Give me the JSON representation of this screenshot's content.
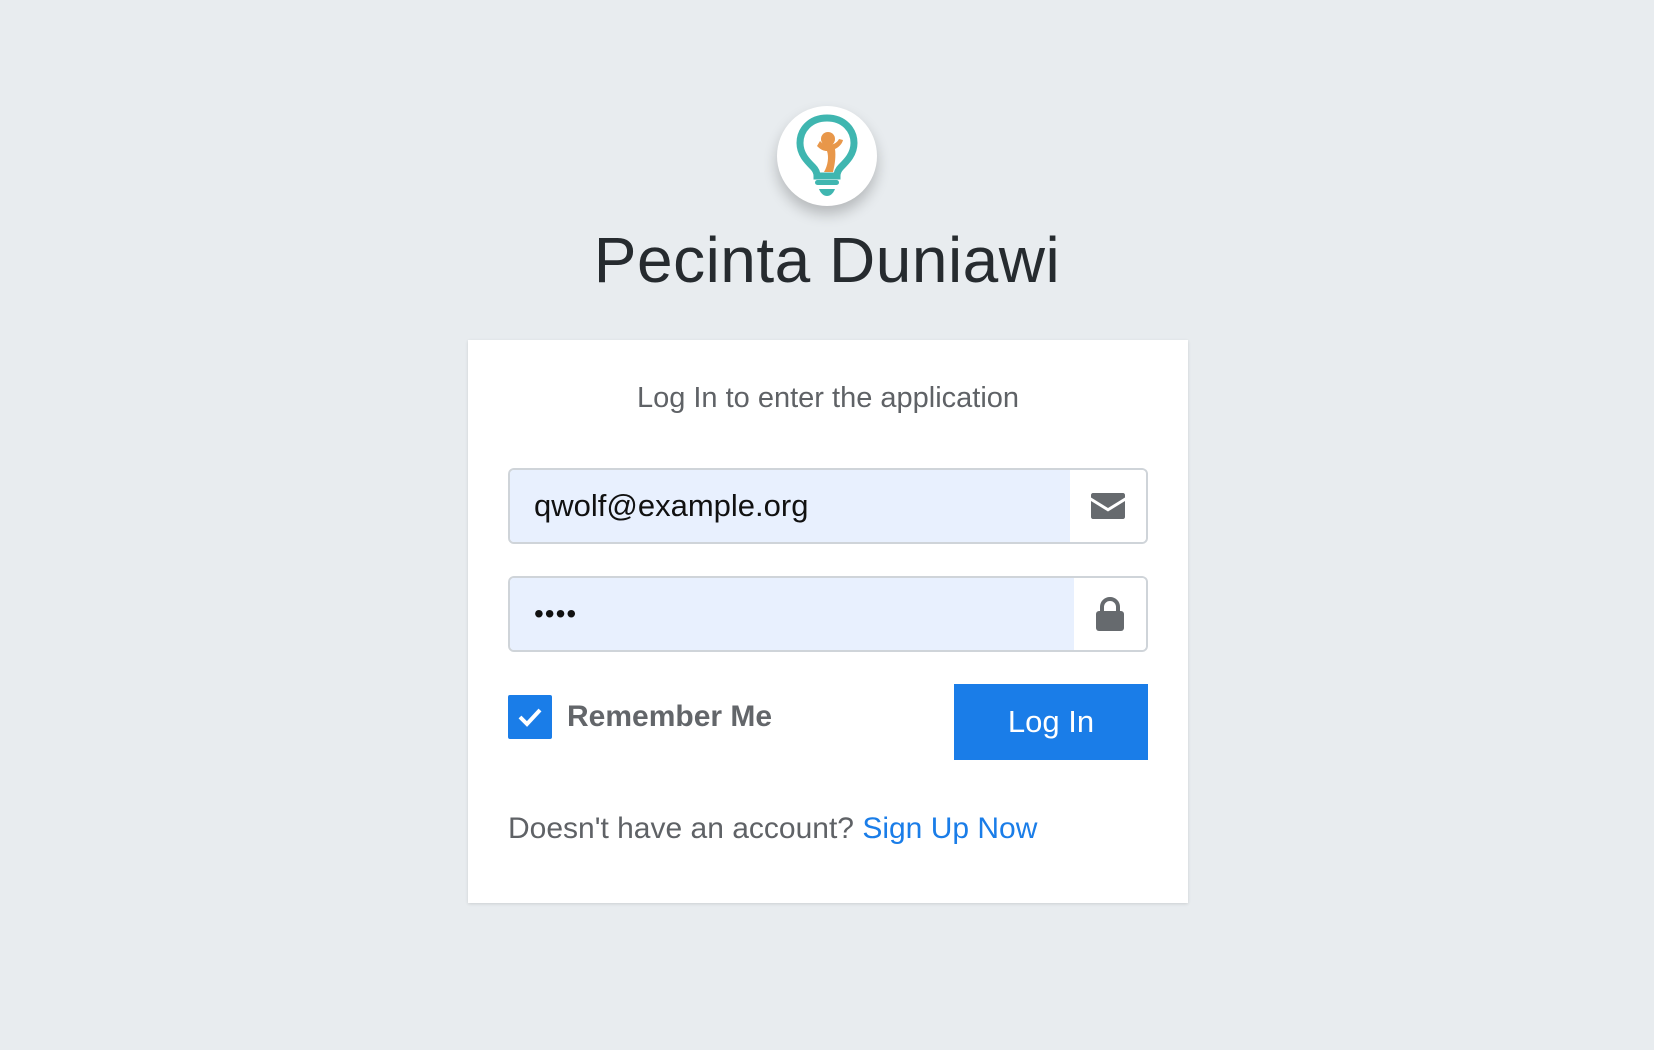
{
  "brand": {
    "logo_icon": "lightbulb-person-logo",
    "app_title": "Pecinta Duniawi"
  },
  "login_card": {
    "subtitle": "Log In to enter the application",
    "email": {
      "value": "qwolf@example.org",
      "icon": "envelope-icon"
    },
    "password": {
      "value": "1234",
      "icon": "lock-icon"
    },
    "remember_me": {
      "label": "Remember Me",
      "checked": true
    },
    "login_button_label": "Log In",
    "signup_prompt": "Doesn't have an account?",
    "signup_link_label": "Sign Up Now"
  },
  "colors": {
    "background": "#e8ecef",
    "accent": "#1a7de8",
    "input_autofill": "#e8f0fe",
    "logo_teal": "#3fb6b0",
    "logo_orange": "#e8974a"
  }
}
